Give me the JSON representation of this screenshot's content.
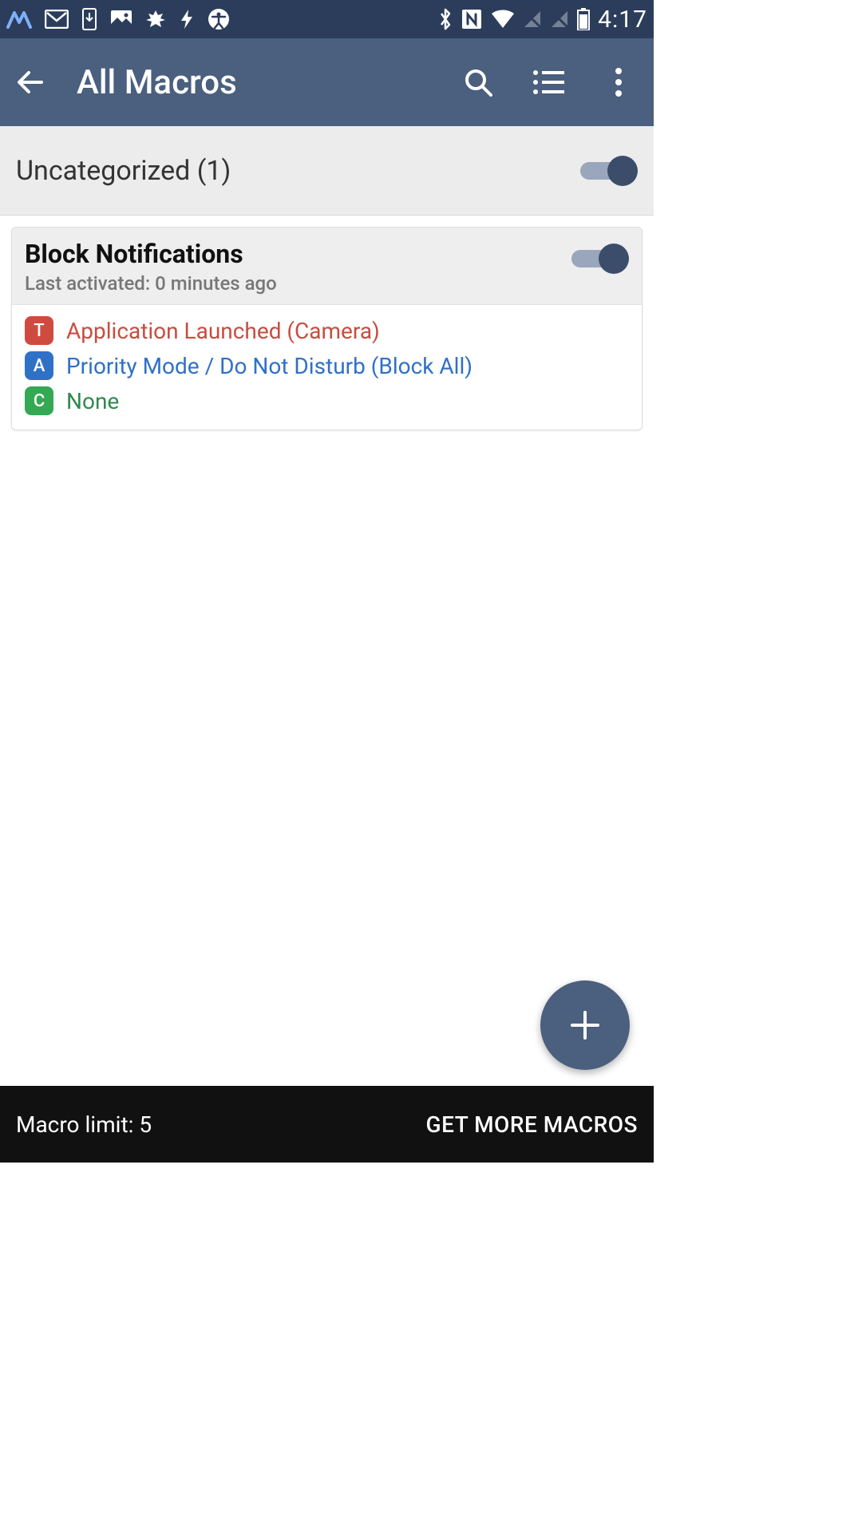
{
  "status": {
    "time": "4:17"
  },
  "toolbar": {
    "title": "All Macros"
  },
  "category": {
    "label": "Uncategorized (1)",
    "enabled": true
  },
  "macro": {
    "title": "Block Notifications",
    "subtitle": "Last activated: 0 minutes ago",
    "enabled": true,
    "trigger": {
      "badge": "T",
      "text": "Application Launched (Camera)"
    },
    "action": {
      "badge": "A",
      "text": "Priority Mode / Do Not Disturb (Block All)"
    },
    "constraint": {
      "badge": "C",
      "text": "None"
    }
  },
  "bottom": {
    "limit_label": "Macro limit: 5",
    "cta": "GET MORE MACROS"
  }
}
